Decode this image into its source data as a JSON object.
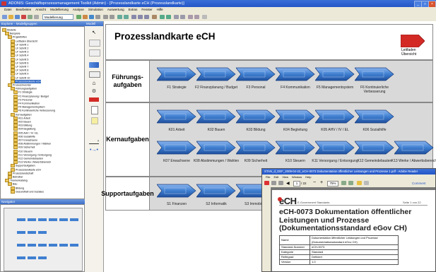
{
  "app": {
    "title": "ADONIS: Geschäftsprozessmanagement Toolkit (Admin) - [Prozesslandkarte eCH (Prozesslandkarte)]",
    "menu": [
      "Datei",
      "Bearbeiten",
      "Ansicht",
      "Modellierung",
      "Analyse",
      "Simulation",
      "Auswertung",
      "Extras",
      "Fenster",
      "Hilfe"
    ],
    "mode_selector": "Modellierung"
  },
  "tree": {
    "header": "Explorer - Modellgruppen",
    "items": [
      {
        "label": "Modelle",
        "indent": 0
      },
      {
        "label": "Beispiele",
        "indent": 1
      },
      {
        "label": "Projekthilfen",
        "indent": 2
      },
      {
        "label": "Leitfaden Übersicht",
        "indent": 3
      },
      {
        "label": "LF Schritt 1",
        "indent": 3
      },
      {
        "label": "LF Schritt 2",
        "indent": 3
      },
      {
        "label": "LF Schritt 3",
        "indent": 3
      },
      {
        "label": "LF Schritt 4",
        "indent": 3
      },
      {
        "label": "LF Schritt 5",
        "indent": 3
      },
      {
        "label": "LF Schritt 6",
        "indent": 3
      },
      {
        "label": "LF Schritt 7",
        "indent": 3
      },
      {
        "label": "LF Schritt 8",
        "indent": 3
      },
      {
        "label": "LF Schritt 9",
        "indent": 3
      },
      {
        "label": "LF Schritt 10",
        "indent": 3
      },
      {
        "label": "Prozesslandkarte eCH",
        "indent": 3,
        "selected": true
      },
      {
        "label": "Prozessinventar",
        "indent": 2
      },
      {
        "label": "Führungsaufgaben",
        "indent": 3
      },
      {
        "label": "F1 Strategie",
        "indent": 4
      },
      {
        "label": "F2 Finanzplanung / Budget",
        "indent": 4
      },
      {
        "label": "F3 Personal",
        "indent": 4
      },
      {
        "label": "F4 Kommunikation",
        "indent": 4
      },
      {
        "label": "F5 Managementsystem",
        "indent": 4
      },
      {
        "label": "F6 Kontinuierliche Verbesserung",
        "indent": 4
      },
      {
        "label": "Kernaufgaben",
        "indent": 3
      },
      {
        "label": "K01 Arbeit",
        "indent": 4
      },
      {
        "label": "K02 Bauen",
        "indent": 4
      },
      {
        "label": "K03 Bildung",
        "indent": 4
      },
      {
        "label": "K04 Begleitung",
        "indent": 4
      },
      {
        "label": "K05 AHV / IV / EL",
        "indent": 4
      },
      {
        "label": "K06 Sozialhilfe",
        "indent": 4
      },
      {
        "label": "K07 Erwachsene",
        "indent": 4
      },
      {
        "label": "K08 Abstimmungen / Wahlen",
        "indent": 4
      },
      {
        "label": "K09 Sicherheit",
        "indent": 4
      },
      {
        "label": "K10 Steuern",
        "indent": 4
      },
      {
        "label": "K11 Versorgung / Entsorgung",
        "indent": 4
      },
      {
        "label": "K12 Gemeindebauten",
        "indent": 4
      },
      {
        "label": "K13 Werke / Abwerbsbereich",
        "indent": 4
      },
      {
        "label": "Supportaufgaben",
        "indent": 3
      },
      {
        "label": "Prozesslandkarte eCH",
        "indent": 3
      },
      {
        "label": "Prozesslandschaft",
        "indent": 2
      },
      {
        "label": "Betreiber",
        "indent": 2
      },
      {
        "label": "Themenkatalog",
        "indent": 1
      },
      {
        "label": "Bau",
        "indent": 2
      },
      {
        "label": "Bildung",
        "indent": 3
      },
      {
        "label": "Gesundheit und Soziales",
        "indent": 3
      }
    ]
  },
  "navigator": {
    "header": "Navigator"
  },
  "palette": {
    "header": "Modell"
  },
  "map": {
    "title": "Prozesslandkarte eCH",
    "legend_label": "Leitfaden Übersicht",
    "sections": [
      {
        "label": "Führungs-\naufgaben",
        "rows": [
          [
            "F1 Strategie",
            "F2 Finanzplanung / Budget",
            "F3 Personal",
            "F4 Kommunikation",
            "F5 Managementsystem",
            "F6 Kontinuierliche Verbesserung"
          ]
        ]
      },
      {
        "label": "Kernaufgaben",
        "rows": [
          [
            "K01 Arbeit",
            "K02 Bauen",
            "K03 Bildung",
            "K04 Begleitung",
            "K05 AHV / IV / EL",
            "K06 Sozialhilfe"
          ],
          [
            "K07 Erwachsene",
            "K08 Abstimmungen / Wahlen",
            "K09 Sicherheit",
            "K10 Steuern",
            "K11 Versorgung / Entsorgung",
            "K12 Gemeindebauten",
            "K13 Werke / Abwerbsbereich"
          ]
        ]
      },
      {
        "label": "Supportaufgaben",
        "rows": [
          [
            "S1 Finanzen",
            "S2 Informatik",
            "S3 Immobilien"
          ]
        ]
      }
    ]
  },
  "pdf": {
    "title": "STAN_d_DEF_2009-04-22_eCH-0073 Dokumentation öffentlicher Leistungen und Prozesse 1.pdf - Adobe Reader",
    "menu": [
      "File",
      "Edit",
      "View",
      "Window",
      "Help"
    ],
    "page_num": "1",
    "page_total": "/ 22",
    "zoom": "75%",
    "comment": "Comment",
    "logo": "eCH",
    "standards": "E-Government Standards",
    "page_label": "Seite 1 von 22",
    "heading": "eCH-0073 Dokumentation öffentlicher Leistungen und Prozesse (Dokumentationsstandard eGov CH)",
    "table": [
      [
        "Name",
        "Dokumentation öffentlicher Leistungen und Prozesse (Dokumentationsstandard eGov CH)"
      ],
      [
        "Standard-Nummer",
        "eCH-0073"
      ],
      [
        "Kategorie",
        "Standard"
      ],
      [
        "Reifegrad",
        "Definiert"
      ],
      [
        "Version",
        "1.0"
      ]
    ]
  },
  "colors": {
    "accent": "#2456c6",
    "process": "#3f7fd0",
    "legend": "#d32a26"
  }
}
